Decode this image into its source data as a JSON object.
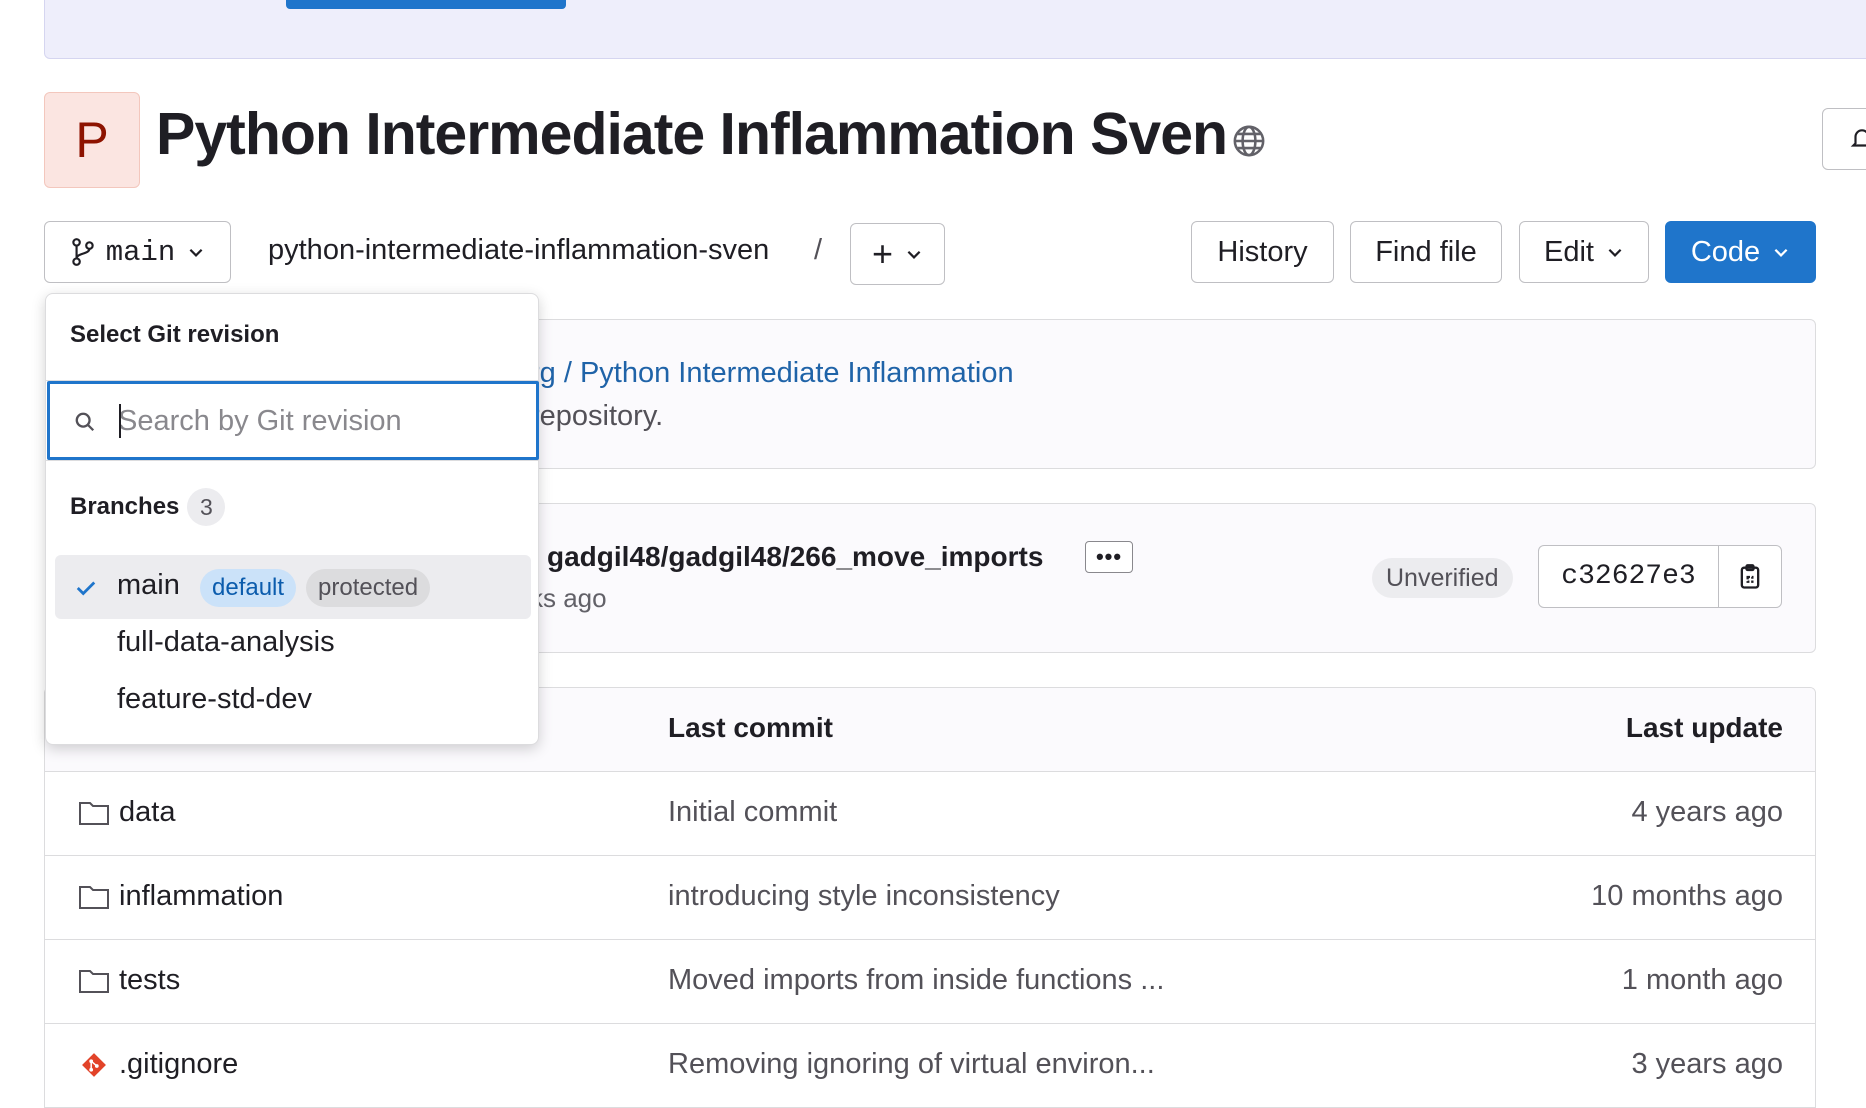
{
  "project": {
    "avatar_letter": "P",
    "title": "Python Intermediate Inflammation Sven",
    "visibility_icon": "globe-icon"
  },
  "toolbar": {
    "branch": "main",
    "repo_path": "python-intermediate-inflammation-sven",
    "path_separator": "/",
    "add_label": "+",
    "history_label": "History",
    "find_file_label": "Find file",
    "edit_label": "Edit",
    "code_label": "Code"
  },
  "fork_info": {
    "link_text": "rg / Python Intermediate Inflammation",
    "text": "repository."
  },
  "last_commit": {
    "title": "gadgil48/gadgil48/266_move_imports",
    "more_label": "•••",
    "time": "ks ago",
    "signature_status": "Unverified",
    "sha": "c32627e3"
  },
  "file_table": {
    "headers": {
      "last_commit": "Last commit",
      "last_update": "Last update"
    },
    "rows": [
      {
        "icon": "folder-icon",
        "name": "data",
        "last_commit": "Initial commit",
        "last_update": "4 years ago"
      },
      {
        "icon": "folder-icon",
        "name": "inflammation",
        "last_commit": "introducing style inconsistency",
        "last_update": "10 months ago"
      },
      {
        "icon": "folder-icon",
        "name": "tests",
        "last_commit": "Moved imports from inside functions ...",
        "last_update": "1 month ago"
      },
      {
        "icon": "git-icon",
        "name": ".gitignore",
        "last_commit": "Removing ignoring of virtual environ...",
        "last_update": "3 years ago"
      }
    ]
  },
  "revision_dropdown": {
    "header": "Select Git revision",
    "search_placeholder": "Search by Git revision",
    "group_label": "Branches",
    "group_count": "3",
    "items": [
      {
        "label": "main",
        "selected": true,
        "badges": [
          "default",
          "protected"
        ]
      },
      {
        "label": "full-data-analysis",
        "selected": false
      },
      {
        "label": "feature-std-dev",
        "selected": false
      }
    ]
  },
  "colors": {
    "primary": "#1f75cb",
    "avatar_bg": "#fbe5e1",
    "avatar_text": "#8d1300",
    "link": "#1f63a8",
    "git_icon": "#e24329"
  }
}
